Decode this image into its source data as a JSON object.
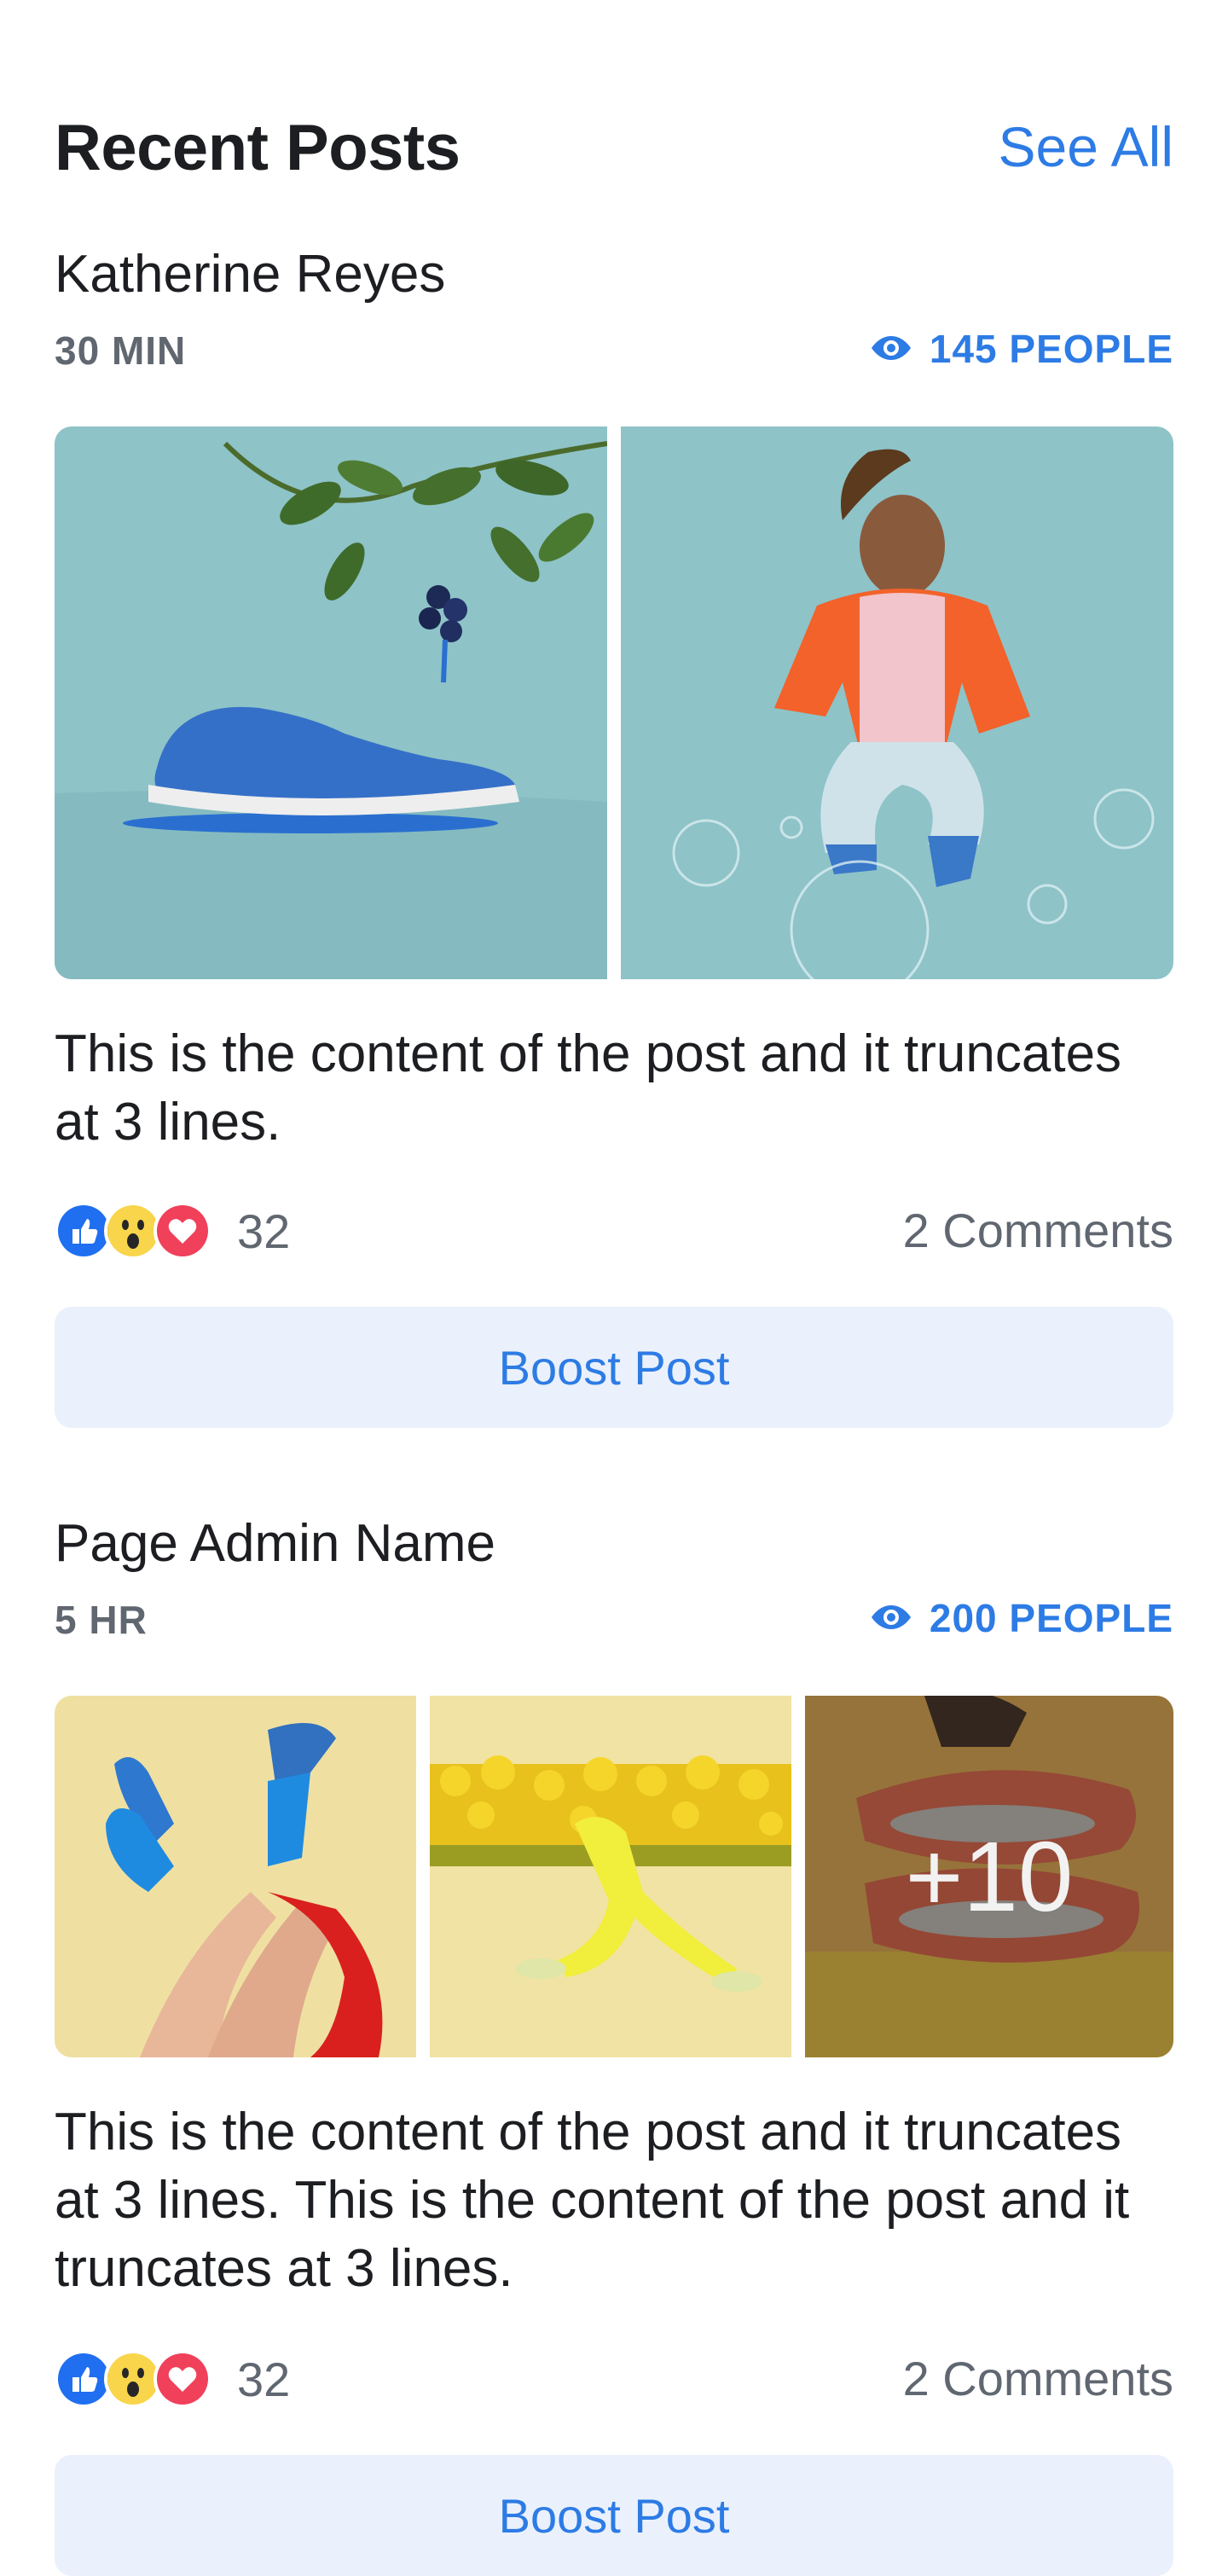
{
  "header": {
    "title": "Recent Posts",
    "see_all": "See All"
  },
  "posts": [
    {
      "author": "Katherine Reyes",
      "time": "30 MIN",
      "reach": "145 PEOPLE",
      "content": "This is the content of the post and it truncates at 3 lines.",
      "reaction_count": "32",
      "comments": "2 Comments",
      "boost_label": "Boost Post"
    },
    {
      "author": "Page Admin Name",
      "time": "5 HR",
      "reach": "200 PEOPLE",
      "content": "This is the content of the post and it truncates at 3 lines. This is the content of the post and it truncates at 3 lines.",
      "reaction_count": "32",
      "comments": "2 Comments",
      "boost_label": "Boost Post",
      "more_photos": "+10"
    }
  ],
  "icons": {
    "reach": "eye-icon",
    "reactions": [
      "like-icon",
      "wow-icon",
      "love-icon"
    ]
  },
  "colors": {
    "accent": "#2d7be5",
    "boost_bg": "#eaf1fc",
    "muted_text": "#606770",
    "teal_photo": "#8fc4c9",
    "yellow_photo": "#efe0a0"
  }
}
